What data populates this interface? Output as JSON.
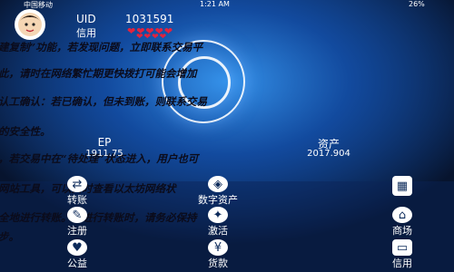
{
  "status": {
    "carrier": "中国移动",
    "time": "1:21 AM",
    "battery": "26%"
  },
  "header": {
    "uid_label": "UID",
    "uid_value": "1031591",
    "credit_label": "信用",
    "hearts": "❤❤❤❤❤",
    "hearts_top": "❤❤❤❤"
  },
  "overlay_lines": [
    "建复制”功能，若发现问题，立即联系交易平",
    "此，请时在网络繁忙期更快拨打可能会增加",
    "认工确认：若已确认，但未到账，则联系交易",
    "的安全性。",
    "，若交易中在“待处理”状态进入，用户也可",
    "网站工具，可以实时查看以太坊网络状",
    "全地进行转账。在进行转账时，请务必保持",
    "步。"
  ],
  "balances": [
    {
      "name": "EP",
      "value": "1911.75"
    },
    {
      "name": "资产",
      "value": "2017.904"
    }
  ],
  "grid": [
    {
      "label": "转账",
      "icon": "transfer-icon"
    },
    {
      "label": "数字资产",
      "icon": "digital-asset-icon"
    },
    {
      "label": "",
      "icon": "qrcode-icon"
    },
    {
      "label": "注册",
      "icon": "register-icon"
    },
    {
      "label": "激活",
      "icon": "activate-icon"
    },
    {
      "label": "商场",
      "icon": "mall-icon"
    },
    {
      "label": "公益",
      "icon": "charity-icon"
    },
    {
      "label": "货款",
      "icon": "loan-icon"
    },
    {
      "label": "信用",
      "icon": "credit-card-icon"
    }
  ]
}
